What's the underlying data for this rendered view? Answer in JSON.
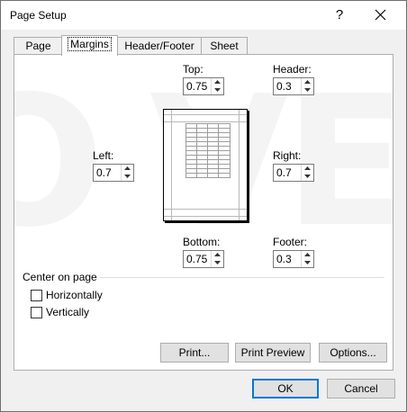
{
  "window": {
    "title": "Page Setup",
    "help": "?"
  },
  "tabs": [
    {
      "label": "Page"
    },
    {
      "label": "Margins"
    },
    {
      "label": "Header/Footer"
    },
    {
      "label": "Sheet"
    }
  ],
  "margins": {
    "top": {
      "label": "Top:",
      "value": "0.75"
    },
    "header": {
      "label": "Header:",
      "value": "0.3"
    },
    "left": {
      "label": "Left:",
      "value": "0.7"
    },
    "right": {
      "label": "Right:",
      "value": "0.7"
    },
    "bottom": {
      "label": "Bottom:",
      "value": "0.75"
    },
    "footer": {
      "label": "Footer:",
      "value": "0.3"
    }
  },
  "center": {
    "title": "Center on page",
    "horizontally": {
      "label": "Horizontally",
      "checked": false
    },
    "vertically": {
      "label": "Vertically",
      "checked": false
    }
  },
  "buttons": {
    "print": "Print...",
    "preview": "Print Preview",
    "options": "Options...",
    "ok": "OK",
    "cancel": "Cancel"
  }
}
